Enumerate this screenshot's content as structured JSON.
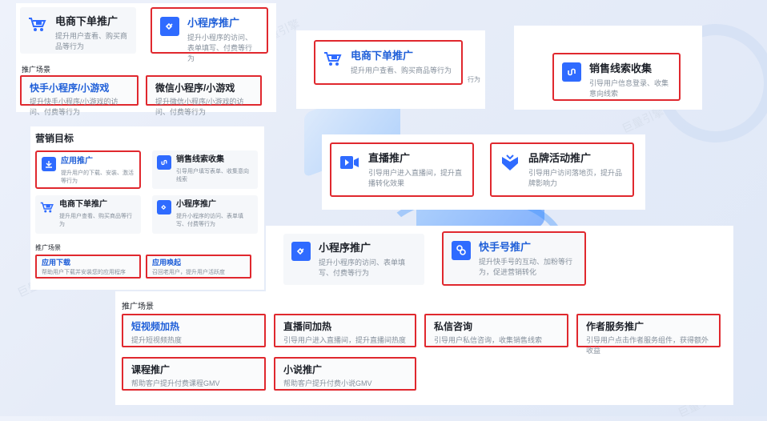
{
  "watermark": "巨量引擎",
  "panel1": {
    "card_ecom": {
      "title": "电商下单推广",
      "desc": "提升用户查看、购买商品等行为"
    },
    "card_mini": {
      "title": "小程序推广",
      "desc": "提升小程序的访问、表单填写、付费等行为"
    },
    "section": "推广场景",
    "scene_ks_mini": {
      "title": "快手小程序/小游戏",
      "desc": "提升快手小程序/小游戏的访问、付费等行为"
    },
    "scene_wx_mini": {
      "title": "微信小程序/小游戏",
      "desc": "提升微信小程序/小游戏的访问、付费等行为"
    }
  },
  "panel2": {
    "card_ecom": {
      "title": "电商下单推广",
      "desc": "提升用户查看、购买商品等行为"
    },
    "peek_text": "行为"
  },
  "panel3": {
    "card_leads": {
      "title": "销售线索收集",
      "desc": "引导用户信息登录、收集意向线索"
    }
  },
  "panel4": {
    "section": "营销目标",
    "card_app": {
      "title": "应用推广",
      "desc": "提升用户的下载、安装、激活等行为"
    },
    "card_leads": {
      "title": "销售线索收集",
      "desc": "引导用户填写表单、收集意向线索"
    },
    "card_ecom": {
      "title": "电商下单推广",
      "desc": "提升用户查看、购买商品等行为"
    },
    "card_mini": {
      "title": "小程序推广",
      "desc": "提升小程序的访问、表单填写、付费等行为"
    },
    "section2": "推广场景",
    "scene_download": {
      "title": "应用下载",
      "desc": "帮助用户下载并安装您的应用程序"
    },
    "scene_awaken": {
      "title": "应用唤起",
      "desc": "召回老用户，提升用户活跃度"
    }
  },
  "panel5": {
    "card_live": {
      "title": "直播推广",
      "desc": "引导用户进入直播间，提升直播转化效果"
    },
    "card_brand": {
      "title": "品牌活动推广",
      "desc": "引导用户访问落地页，提升品牌影响力"
    }
  },
  "panel6": {
    "card_mini": {
      "title": "小程序推广",
      "desc": "提升小程序的访问、表单填写、付费等行为"
    },
    "card_kuaishou": {
      "title": "快手号推广",
      "desc": "提升快手号的互动、加粉等行为，促进营销转化"
    },
    "section": "推广场景",
    "scene_short": {
      "title": "短视频加热",
      "desc": "提升短视频热度"
    },
    "scene_live": {
      "title": "直播间加热",
      "desc": "引导用户进入直播间，提升直播间热度"
    },
    "scene_dm": {
      "title": "私信咨询",
      "desc": "引导用户私信咨询，收集销售线索"
    },
    "scene_author": {
      "title": "作者服务推广",
      "desc": "引导用户点击作者服务组件，获得额外收益"
    },
    "scene_course": {
      "title": "课程推广",
      "desc": "帮助客户提升付费课程GMV"
    },
    "scene_novel": {
      "title": "小说推广",
      "desc": "帮助客户提升付费小说GMV"
    }
  },
  "colors": {
    "accent": "#2f6bff",
    "highlight": "#e0282e"
  }
}
